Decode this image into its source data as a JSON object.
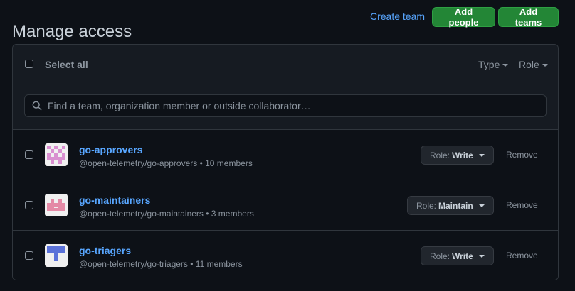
{
  "header": {
    "title": "Manage access",
    "create_team": "Create team",
    "add_people": "Add people",
    "add_teams": "Add teams"
  },
  "toolbar": {
    "select_all": "Select all",
    "type_filter": "Type",
    "role_filter": "Role"
  },
  "search": {
    "placeholder": "Find a team, organization member or outside collaborator…"
  },
  "teams": [
    {
      "name": "go-approvers",
      "description": "@open-telemetry/go-approvers • 10 members",
      "role_prefix": "Role:",
      "role": "Write",
      "remove": "Remove"
    },
    {
      "name": "go-maintainers",
      "description": "@open-telemetry/go-maintainers • 3 members",
      "role_prefix": "Role:",
      "role": "Maintain",
      "remove": "Remove"
    },
    {
      "name": "go-triagers",
      "description": "@open-telemetry/go-triagers • 11 members",
      "role_prefix": "Role:",
      "role": "Write",
      "remove": "Remove"
    }
  ],
  "colors": {
    "accent_link": "#58a6ff",
    "primary_button": "#238636",
    "avatar_approvers": "#d98fd0",
    "avatar_maintainers": "#e48aa6",
    "avatar_triagers": "#5b72d9"
  }
}
